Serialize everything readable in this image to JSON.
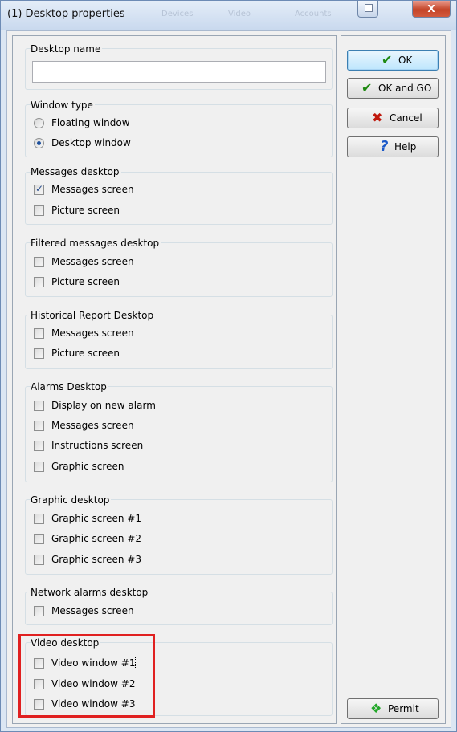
{
  "window": {
    "title": "(1) Desktop properties",
    "background_ghost_texts": [
      "Devices",
      "Video",
      "Accounts"
    ],
    "close_glyph": "X",
    "restore_icon": "restore-icon"
  },
  "desktop_name": {
    "label": "Desktop name",
    "value": ""
  },
  "window_type": {
    "label": "Window type",
    "options": [
      {
        "label": "Floating window",
        "selected": false
      },
      {
        "label": "Desktop window",
        "selected": true
      }
    ]
  },
  "groups": {
    "messages": {
      "label": "Messages desktop",
      "items": [
        {
          "label": "Messages screen",
          "checked": true
        },
        {
          "label": "Picture screen",
          "checked": false
        }
      ]
    },
    "filtered": {
      "label": "Filtered messages desktop",
      "items": [
        {
          "label": "Messages screen",
          "checked": false
        },
        {
          "label": "Picture screen",
          "checked": false
        }
      ]
    },
    "historical": {
      "label": "Historical Report Desktop",
      "items": [
        {
          "label": "Messages screen",
          "checked": false
        },
        {
          "label": "Picture screen",
          "checked": false
        }
      ]
    },
    "alarms": {
      "label": "Alarms Desktop",
      "items": [
        {
          "label": "Display on new alarm",
          "checked": false
        },
        {
          "label": "Messages screen",
          "checked": false
        },
        {
          "label": "Instructions screen",
          "checked": false
        },
        {
          "label": "Graphic screen",
          "checked": false
        }
      ]
    },
    "graphic": {
      "label": "Graphic desktop",
      "items": [
        {
          "label": "Graphic screen #1",
          "checked": false
        },
        {
          "label": "Graphic screen #2",
          "checked": false
        },
        {
          "label": "Graphic screen #3",
          "checked": false
        }
      ]
    },
    "network": {
      "label": "Network alarms desktop",
      "items": [
        {
          "label": "Messages screen",
          "checked": false
        }
      ]
    },
    "video": {
      "label": "Video desktop",
      "items": [
        {
          "label": "Video window #1",
          "checked": false
        },
        {
          "label": "Video window #2",
          "checked": false
        },
        {
          "label": "Video window #3",
          "checked": false
        }
      ]
    }
  },
  "buttons": {
    "ok": {
      "label": "OK",
      "icon": "checkmark-icon"
    },
    "ok_go": {
      "label": "OK and GO",
      "icon": "checkmark-icon"
    },
    "cancel": {
      "label": "Cancel",
      "icon": "red-x-icon"
    },
    "help": {
      "label": "Help",
      "icon": "question-mark-icon"
    },
    "permit": {
      "label": "Permit",
      "icon": "running-man-icon"
    }
  },
  "colors": {
    "highlight_box": "#e02020",
    "title_bar": "#c9d9ee",
    "dialog_bg": "#f0f0f0"
  }
}
